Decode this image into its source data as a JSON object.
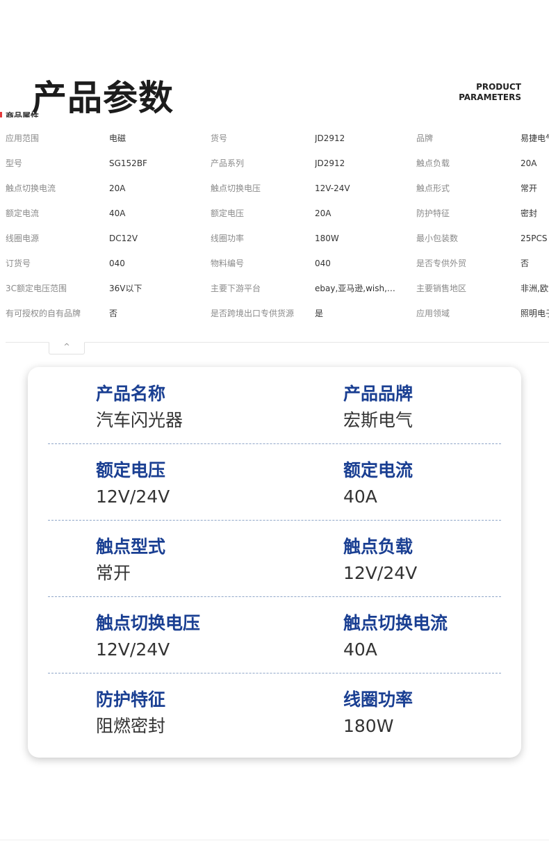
{
  "header": {
    "title_zh": "产品参数",
    "title_en_line1": "PRODUCT",
    "title_en_line2": "PARAMETERS",
    "attr_section": "商品属性"
  },
  "attributes": [
    [
      "应用范围",
      "电磁",
      "货号",
      "JD2912",
      "品牌",
      "易捷电气"
    ],
    [
      "型号",
      "SG152BF",
      "产品系列",
      "JD2912",
      "触点负载",
      "20A"
    ],
    [
      "触点切换电流",
      "20A",
      "触点切换电压",
      "12V-24V",
      "触点形式",
      "常开"
    ],
    [
      "额定电流",
      "40A",
      "额定电压",
      "20A",
      "防护特征",
      "密封"
    ],
    [
      "线圈电源",
      "DC12V",
      "线圈功率",
      "180W",
      "最小包装数",
      "25PCS"
    ],
    [
      "订货号",
      "040",
      "物料编号",
      "040",
      "是否专供外贸",
      "否"
    ],
    [
      "3C额定电压范围",
      "36V以下",
      "主要下游平台",
      "ebay,亚马逊,wish,速卖通",
      "主要销售地区",
      "非洲,欧洲"
    ],
    [
      "有可授权的自有品牌",
      "否",
      "是否跨境出口专供货源",
      "是",
      "应用领域",
      "照明电子"
    ]
  ],
  "collapse": {
    "icon": "chevron-up-icon",
    "glyph": "^"
  },
  "specs": [
    {
      "left": {
        "label": "产品名称",
        "value": "汽车闪光器"
      },
      "right": {
        "label": "产品品牌",
        "value": "宏斯电气"
      }
    },
    {
      "left": {
        "label": "额定电压",
        "value": "12V/24V"
      },
      "right": {
        "label": "额定电流",
        "value": "40A"
      }
    },
    {
      "left": {
        "label": "触点型式",
        "value": "常开"
      },
      "right": {
        "label": "触点负载",
        "value": "12V/24V"
      }
    },
    {
      "left": {
        "label": "触点切换电压",
        "value": "12V/24V"
      },
      "right": {
        "label": "触点切换电流",
        "value": "40A"
      }
    },
    {
      "left": {
        "label": "防护特征",
        "value": "阻燃密封"
      },
      "right": {
        "label": "线圈功率",
        "value": "180W"
      }
    }
  ],
  "colors": {
    "spec_label": "#1a3f92",
    "accent_red": "#e4393c",
    "key_text": "#8a8a8a"
  }
}
